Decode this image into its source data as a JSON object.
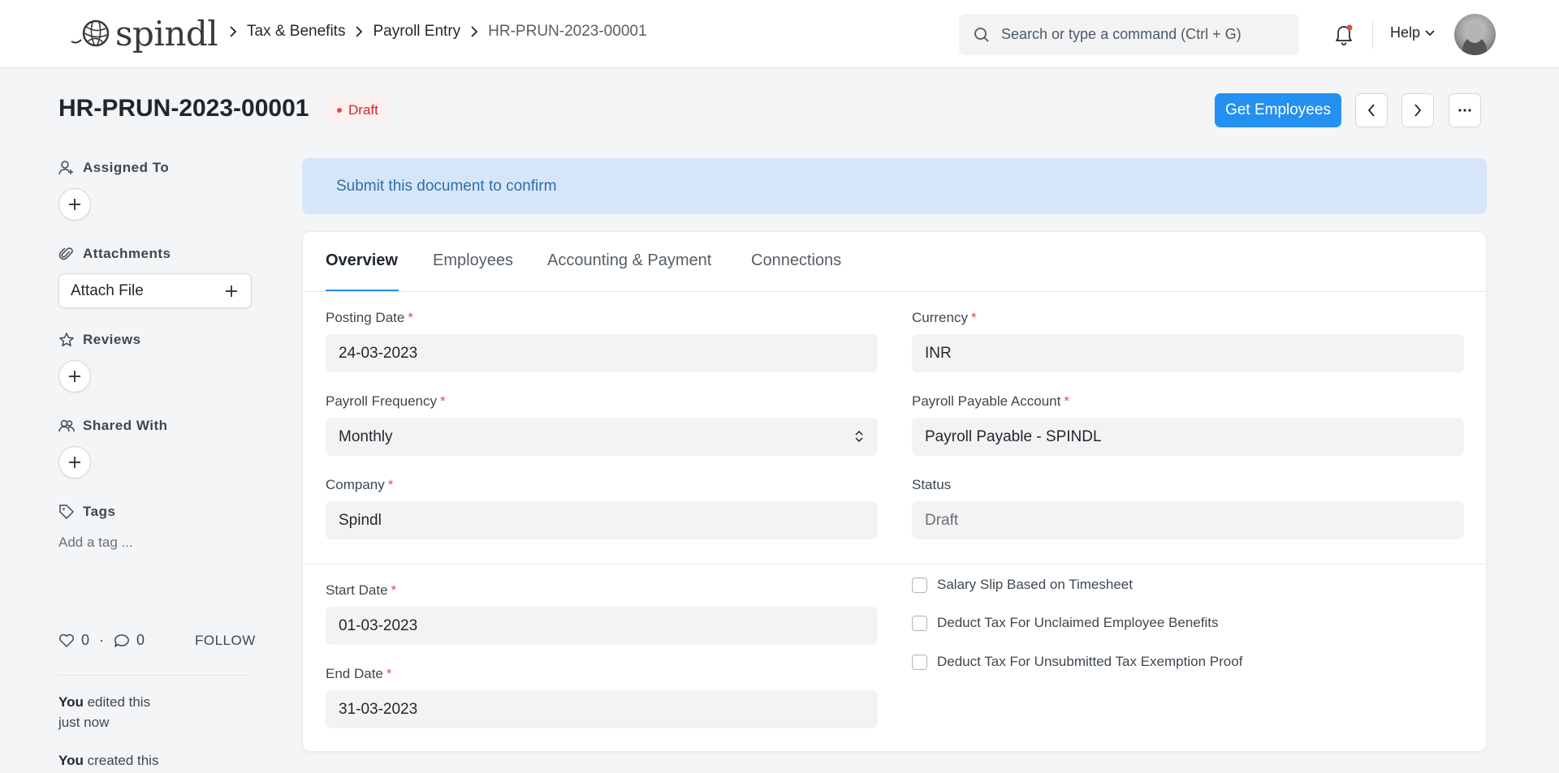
{
  "navbar": {
    "logo_text": "spindl",
    "breadcrumbs": [
      "Tax & Benefits",
      "Payroll Entry"
    ],
    "breadcrumb_current": "HR-PRUN-2023-00001",
    "search_placeholder": "Search or type a command (Ctrl + G)",
    "help_label": "Help"
  },
  "header": {
    "title": "HR-PRUN-2023-00001",
    "status": "Draft",
    "primary_action": "Get Employees",
    "status_color": "#cc2929"
  },
  "sidebar": {
    "assigned_to": "Assigned To",
    "attachments": "Attachments",
    "attach_file": "Attach File",
    "reviews": "Reviews",
    "shared_with": "Shared With",
    "tags": "Tags",
    "add_tag": "Add a tag ...",
    "likes": "0",
    "comments": "0",
    "follow": "FOLLOW",
    "activity": [
      {
        "who": "You",
        "text1": " edited this",
        "text2": "just now"
      },
      {
        "who": "You",
        "text1": " created this"
      }
    ]
  },
  "banner": {
    "text": "Submit this document to confirm"
  },
  "tabs": [
    "Overview",
    "Employees",
    "Accounting & Payment",
    "Connections"
  ],
  "form": {
    "posting_date": {
      "label": "Posting Date",
      "value": "24-03-2023"
    },
    "currency": {
      "label": "Currency",
      "value": "INR"
    },
    "payroll_frequency": {
      "label": "Payroll Frequency",
      "value": "Monthly"
    },
    "payroll_payable_account": {
      "label": "Payroll Payable Account",
      "value": "Payroll Payable - SPINDL"
    },
    "company": {
      "label": "Company",
      "value": "Spindl"
    },
    "status": {
      "label": "Status",
      "value": "Draft"
    },
    "start_date": {
      "label": "Start Date",
      "value": "01-03-2023"
    },
    "end_date": {
      "label": "End Date",
      "value": "31-03-2023"
    },
    "checkboxes": [
      "Salary Slip Based on Timesheet",
      "Deduct Tax For Unclaimed Employee Benefits",
      "Deduct Tax For Unsubmitted Tax Exemption Proof"
    ]
  },
  "colors": {
    "accent": "#2490ef",
    "banner_bg": "#d6e6f8"
  }
}
